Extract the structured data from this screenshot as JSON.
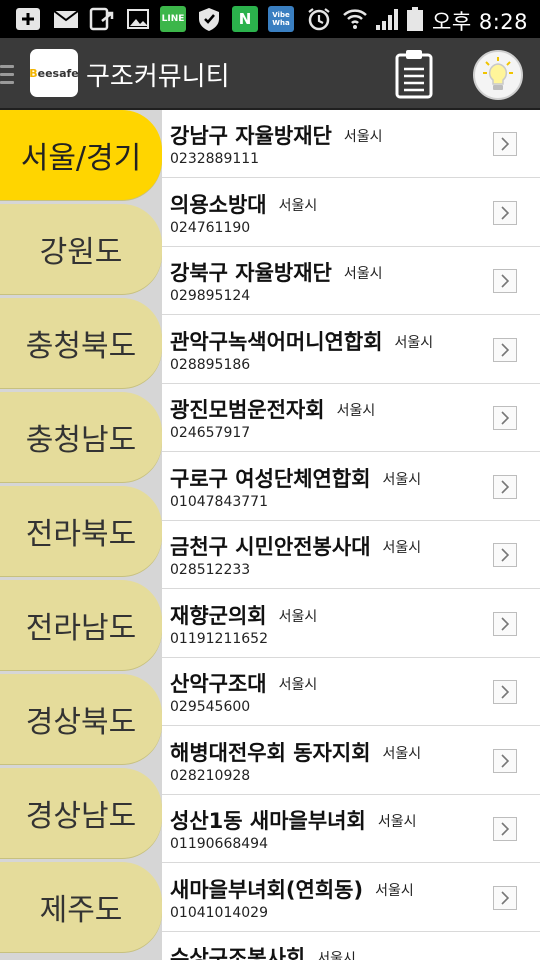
{
  "status_bar": {
    "time": "오후 8:28",
    "left_icons": [
      "add-icon",
      "mail-icon",
      "transfer-icon",
      "image-icon",
      "line-app-icon",
      "shield-icon",
      "n-app-icon",
      "vibe-app-icon"
    ],
    "right_icons": [
      "alarm-icon",
      "wifi-icon",
      "signal-icon",
      "battery-icon"
    ],
    "line_label": "LINE",
    "n_label": "N",
    "vibe_label": "Vibe Wha"
  },
  "app_bar": {
    "logo_prefix": "B",
    "logo_text": "eesafe",
    "title": "구조커뮤니티",
    "icons": [
      "menu-icon",
      "clipboard-icon",
      "lightbulb-icon"
    ]
  },
  "colors": {
    "active_tab": "#ffd500",
    "inactive_tab": "#e5dc9b",
    "app_bar": "#3a3a3a"
  },
  "regions": [
    {
      "label": "서울/경기",
      "active": true
    },
    {
      "label": "강원도",
      "active": false
    },
    {
      "label": "충청북도",
      "active": false
    },
    {
      "label": "충청남도",
      "active": false
    },
    {
      "label": "전라북도",
      "active": false
    },
    {
      "label": "전라남도",
      "active": false
    },
    {
      "label": "경상북도",
      "active": false
    },
    {
      "label": "경상남도",
      "active": false
    },
    {
      "label": "제주도",
      "active": false
    }
  ],
  "organizations": [
    {
      "name": "강남구 자율방재단",
      "city": "서울시",
      "phone": "0232889111"
    },
    {
      "name": "의용소방대",
      "city": "서울시",
      "phone": "024761190"
    },
    {
      "name": "강북구 자율방재단",
      "city": "서울시",
      "phone": "029895124"
    },
    {
      "name": "관악구녹색어머니연합회",
      "city": "서울시",
      "phone": "028895186"
    },
    {
      "name": "광진모범운전자회",
      "city": "서울시",
      "phone": "024657917"
    },
    {
      "name": "구로구 여성단체연합회",
      "city": "서울시",
      "phone": "01047843771"
    },
    {
      "name": "금천구 시민안전봉사대",
      "city": "서울시",
      "phone": "028512233"
    },
    {
      "name": "재향군의회",
      "city": "서울시",
      "phone": "01191211652"
    },
    {
      "name": "산악구조대",
      "city": "서울시",
      "phone": "029545600"
    },
    {
      "name": "해병대전우회 동자지회",
      "city": "서울시",
      "phone": "028210928"
    },
    {
      "name": "성산1동 새마을부녀회",
      "city": "서울시",
      "phone": "01190668494"
    },
    {
      "name": "새마을부녀회(연희동)",
      "city": "서울시",
      "phone": "01041014029"
    },
    {
      "name": "수상구조봉사회",
      "city": "서울시",
      "phone": ""
    }
  ]
}
